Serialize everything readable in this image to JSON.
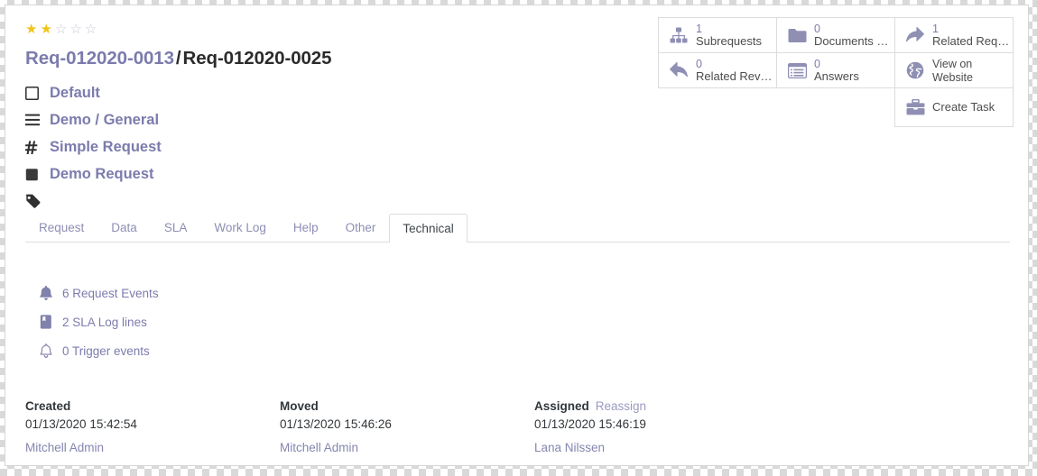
{
  "header": {
    "rating": {
      "filled": 2,
      "total": 5,
      "star_glyph": "★",
      "star_empty_glyph": "☆"
    },
    "parent_ref": "Req-012020-0013",
    "separator": "/",
    "current_ref": "Req-012020-0025",
    "meta": [
      {
        "icon": "square-o-icon",
        "label": "Default"
      },
      {
        "icon": "bars-icon",
        "label": "Demo / General"
      },
      {
        "icon": "hashtag-icon",
        "label": "Simple Request"
      },
      {
        "icon": "square-filled-icon",
        "label": "Demo Request"
      },
      {
        "icon": "tag-icon",
        "label": ""
      }
    ]
  },
  "stat_buttons": [
    {
      "icon": "sitemap-icon",
      "value": "1",
      "label": "Subrequests",
      "two_line": false
    },
    {
      "icon": "folder-icon",
      "value": "0",
      "label": "Documents …",
      "two_line": false
    },
    {
      "icon": "share-icon",
      "value": "1",
      "label": "Related Req…",
      "two_line": false
    },
    {
      "icon": "reply-icon",
      "value": "0",
      "label": "Related Rev…",
      "two_line": false
    },
    {
      "icon": "list-alt-icon",
      "value": "0",
      "label": "Answers",
      "two_line": false
    },
    {
      "icon": "globe-icon",
      "value": "",
      "label": "View on Website",
      "two_line": true
    },
    {
      "icon": "briefcase-icon",
      "value": "",
      "label": "Create Task",
      "two_line": false
    }
  ],
  "tabs": [
    {
      "label": "Request",
      "active": false
    },
    {
      "label": "Data",
      "active": false
    },
    {
      "label": "SLA",
      "active": false
    },
    {
      "label": "Work Log",
      "active": false
    },
    {
      "label": "Help",
      "active": false
    },
    {
      "label": "Other",
      "active": false
    },
    {
      "label": "Technical",
      "active": true
    }
  ],
  "technical": [
    {
      "icon": "bell-filled-icon",
      "label": "6 Request Events"
    },
    {
      "icon": "book-icon",
      "label": "2 SLA Log lines"
    },
    {
      "icon": "bell-outline-icon",
      "label": "0 Trigger events"
    }
  ],
  "footer": [
    {
      "heading": "Created",
      "action": "",
      "date": "01/13/2020 15:42:54",
      "user": "Mitchell Admin"
    },
    {
      "heading": "Moved",
      "action": "",
      "date": "01/13/2020 15:46:26",
      "user": "Mitchell Admin"
    },
    {
      "heading": "Assigned",
      "action": "Reassign",
      "date": "01/13/2020 15:46:19",
      "user": "Lana Nilssen"
    }
  ],
  "colors": {
    "link": "#7c7bad",
    "icon": "#8f8fb4",
    "star_on": "#f0c419",
    "star_off": "#c9c9d6",
    "text": "#32373b",
    "border": "#dddddd"
  }
}
